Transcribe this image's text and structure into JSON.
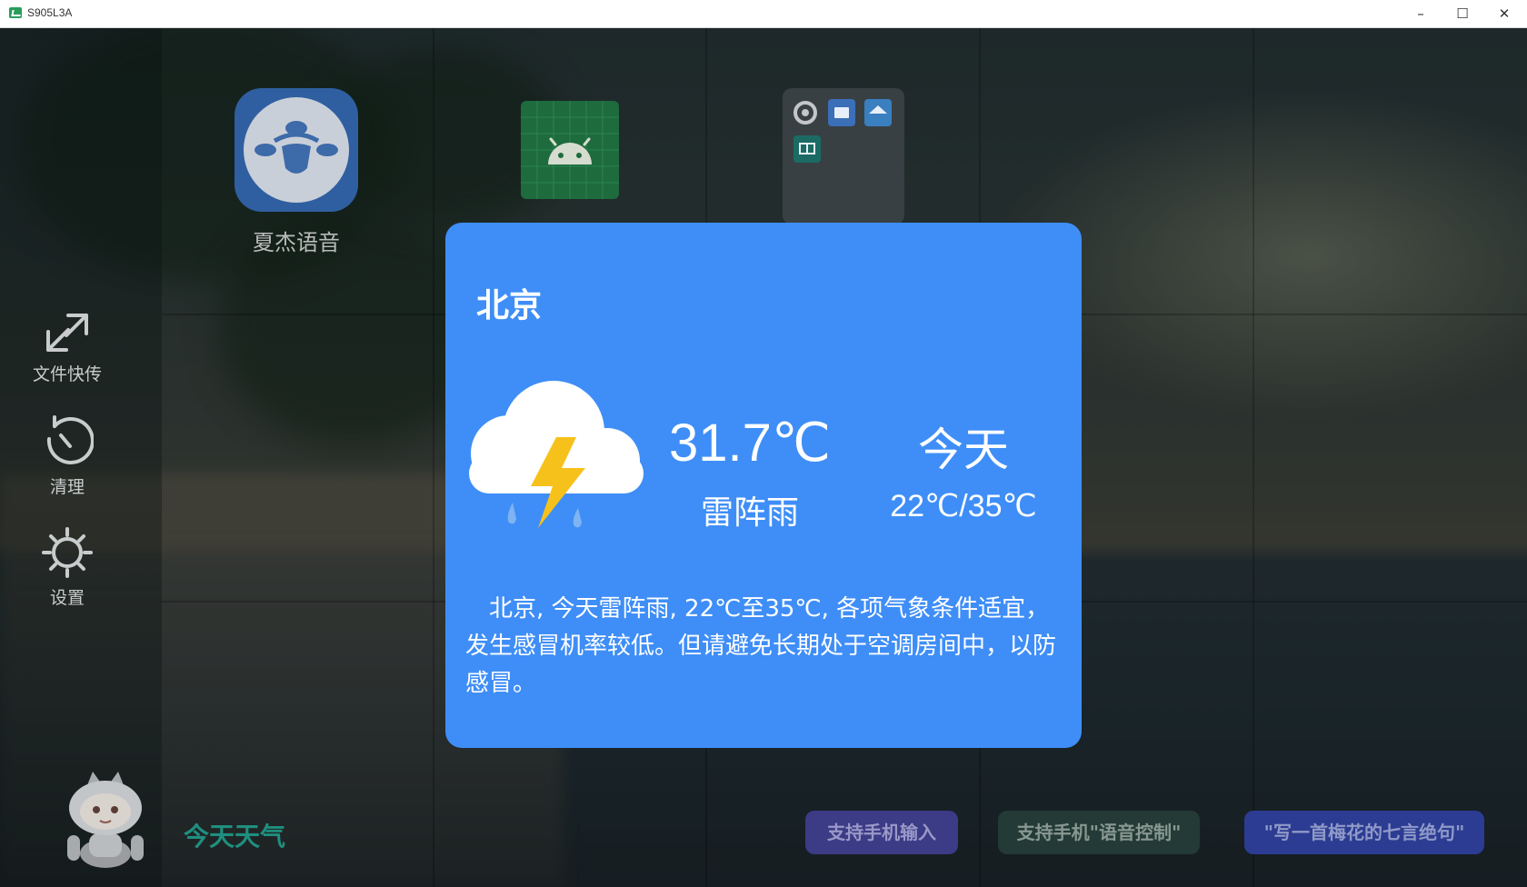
{
  "window": {
    "title": "S905L3A",
    "minimize": "–",
    "maximize": "☐",
    "close": "✕"
  },
  "apps": [
    {
      "label": "夏杰语音",
      "icon": "voice-assistant-icon"
    },
    {
      "label": "",
      "icon": "android-icon"
    },
    {
      "label": "",
      "icon": "app-folder-icon"
    }
  ],
  "sidebar": {
    "items": [
      {
        "label": "文件快传",
        "icon": "file-transfer-icon"
      },
      {
        "label": "清理",
        "icon": "clean-icon"
      },
      {
        "label": "设置",
        "icon": "gear-icon"
      }
    ]
  },
  "assistant": {
    "prompt": "今天天气",
    "icon": "robot-avatar-icon"
  },
  "suggestions": [
    {
      "label": "支持手机输入"
    },
    {
      "label": "支持手机\"语音控制\""
    },
    {
      "label": "\"写一首梅花的七言绝句\""
    }
  ],
  "weather": {
    "city": "北京",
    "temperature": "31.7℃",
    "condition": "雷阵雨",
    "day": "今天",
    "range": "22℃/35℃",
    "icon": "thunderstorm-icon",
    "description": "北京, 今天雷阵雨, 22℃至35℃, 各项气象条件适宜，发生感冒机率较低。但请避免长期处于空调房间中，以防感冒。",
    "background_color": "#3f8ef7"
  }
}
